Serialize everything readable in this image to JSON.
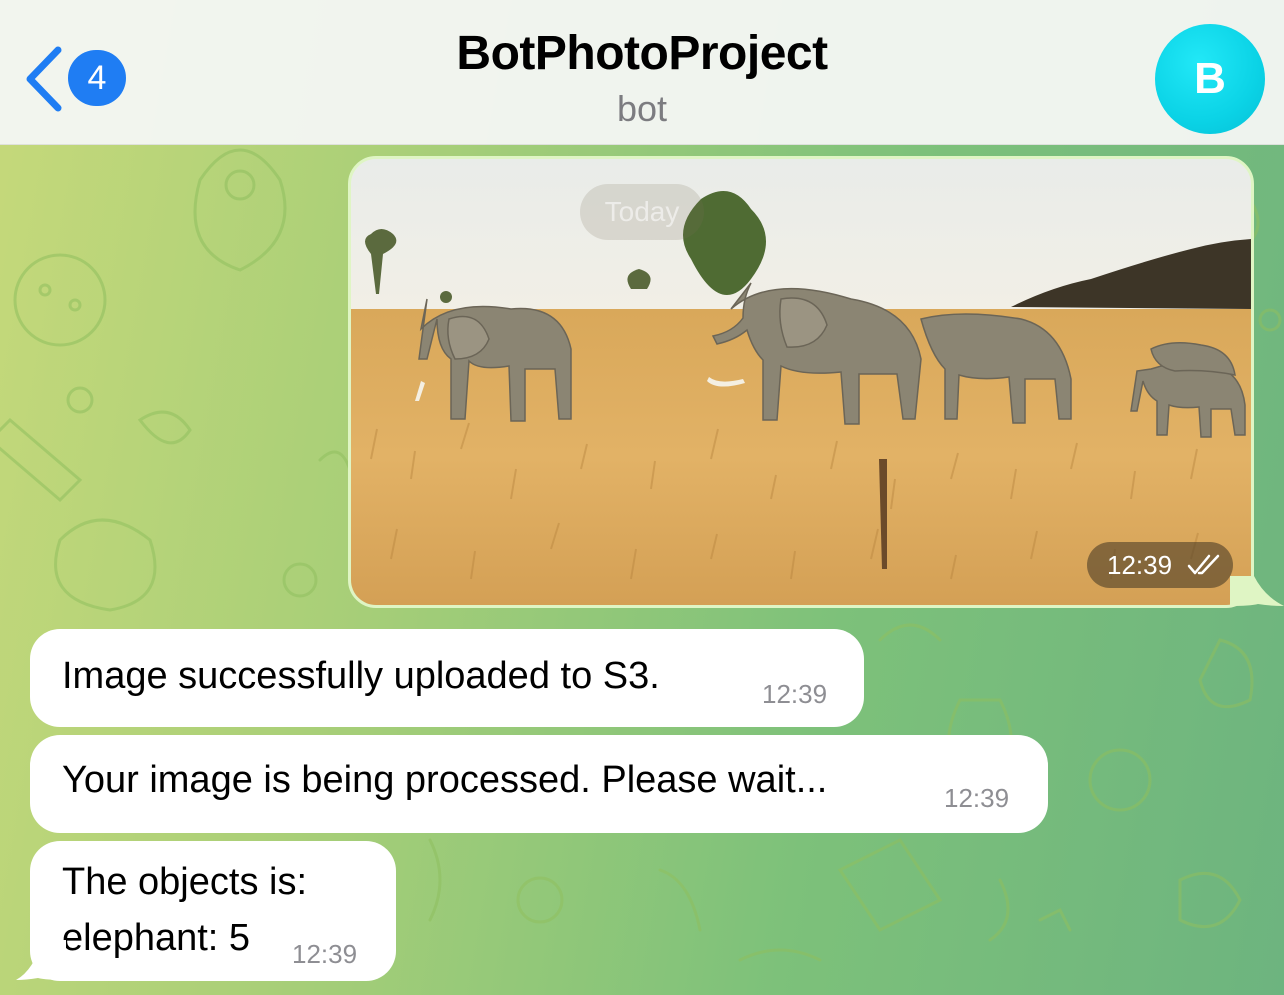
{
  "header": {
    "back_count": "4",
    "title": "BotPhotoProject",
    "subtitle": "bot",
    "avatar_letter": "B"
  },
  "chat": {
    "date_label": "Today",
    "photo_message": {
      "time": "12:39",
      "status_icon": "double-check-icon",
      "image_description_icon": "elephant-photo"
    },
    "messages": [
      {
        "text": "Image successfully uploaded to S3.",
        "time": "12:39"
      },
      {
        "text": "Your image is being processed. Please wait...",
        "time": "12:39"
      },
      {
        "line1": "The objects is:",
        "line2": "elephant: 5",
        "time": "12:39"
      }
    ]
  },
  "colors": {
    "accent": "#1f7df3",
    "avatar": "#0bd3e6",
    "outgoing_bubble": "#dcf8c6",
    "incoming_bubble": "#ffffff"
  }
}
